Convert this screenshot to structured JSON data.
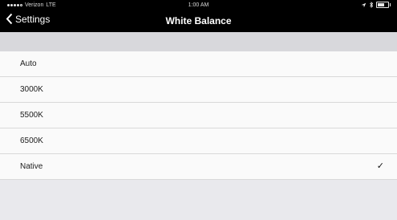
{
  "status_bar": {
    "carrier": "Verizon",
    "network": "LTE",
    "time": "1:00 AM"
  },
  "nav": {
    "back_label": "Settings",
    "title": "White Balance"
  },
  "options": [
    {
      "label": "Auto",
      "selected": false
    },
    {
      "label": "3000K",
      "selected": false
    },
    {
      "label": "5500K",
      "selected": false
    },
    {
      "label": "6500K",
      "selected": false
    },
    {
      "label": "Native",
      "selected": true
    }
  ],
  "checkmark": "✓",
  "icons": {
    "back": "chevron-left-icon",
    "location": "location-arrow-icon",
    "bluetooth": "bluetooth-icon",
    "battery": "battery-icon",
    "signal": "signal-dots-icon"
  },
  "colors": {
    "bar_background": "#000000",
    "row_background": "#fafafa",
    "group_background": "#d8d8dc"
  }
}
